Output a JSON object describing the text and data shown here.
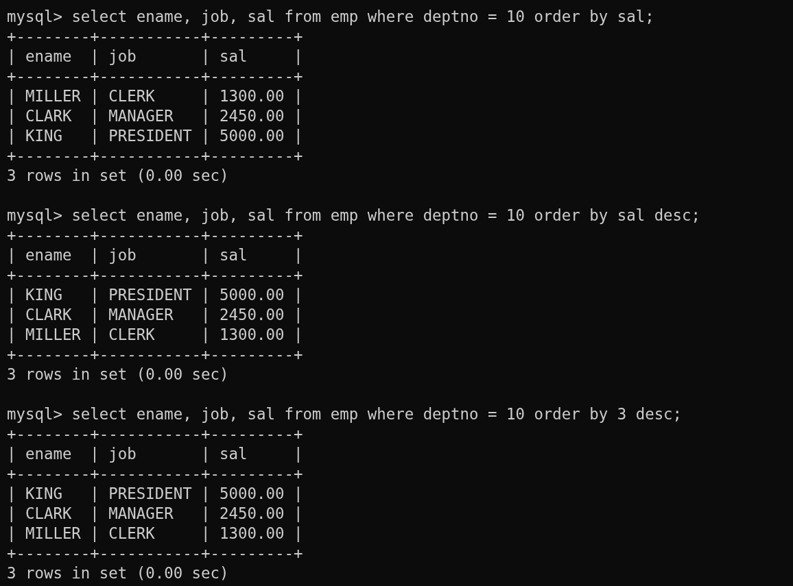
{
  "terminal": {
    "lines": [
      {
        "kind": "command",
        "prompt": "mysql>",
        "text": "select ename, job, sal from emp where deptno = 10 order by sal;"
      },
      {
        "kind": "border",
        "text": "+--------+-----------+---------+"
      },
      {
        "kind": "header",
        "text": "| ename  | job       | sal     |"
      },
      {
        "kind": "border",
        "text": "+--------+-----------+---------+"
      },
      {
        "kind": "row",
        "text": "| MILLER | CLERK     | 1300.00 |"
      },
      {
        "kind": "row",
        "text": "| CLARK  | MANAGER   | 2450.00 |"
      },
      {
        "kind": "row",
        "text": "| KING   | PRESIDENT | 5000.00 |"
      },
      {
        "kind": "border",
        "text": "+--------+-----------+---------+"
      },
      {
        "kind": "status",
        "text": "3 rows in set (0.00 sec)"
      },
      {
        "kind": "blank"
      },
      {
        "kind": "command",
        "prompt": "mysql>",
        "text": "select ename, job, sal from emp where deptno = 10 order by sal desc;"
      },
      {
        "kind": "border",
        "text": "+--------+-----------+---------+"
      },
      {
        "kind": "header",
        "text": "| ename  | job       | sal     |"
      },
      {
        "kind": "border",
        "text": "+--------+-----------+---------+"
      },
      {
        "kind": "row",
        "text": "| KING   | PRESIDENT | 5000.00 |"
      },
      {
        "kind": "row",
        "text": "| CLARK  | MANAGER   | 2450.00 |"
      },
      {
        "kind": "row",
        "text": "| MILLER | CLERK     | 1300.00 |"
      },
      {
        "kind": "border",
        "text": "+--------+-----------+---------+"
      },
      {
        "kind": "status",
        "text": "3 rows in set (0.00 sec)"
      },
      {
        "kind": "blank"
      },
      {
        "kind": "command",
        "prompt": "mysql>",
        "text": "select ename, job, sal from emp where deptno = 10 order by 3 desc;"
      },
      {
        "kind": "border",
        "text": "+--------+-----------+---------+"
      },
      {
        "kind": "header",
        "text": "| ename  | job       | sal     |"
      },
      {
        "kind": "border",
        "text": "+--------+-----------+---------+"
      },
      {
        "kind": "row",
        "text": "| KING   | PRESIDENT | 5000.00 |"
      },
      {
        "kind": "row",
        "text": "| CLARK  | MANAGER   | 2450.00 |"
      },
      {
        "kind": "row",
        "text": "| MILLER | CLERK     | 1300.00 |"
      },
      {
        "kind": "border",
        "text": "+--------+-----------+---------+"
      },
      {
        "kind": "status",
        "text": "3 rows in set (0.00 sec)"
      }
    ]
  }
}
